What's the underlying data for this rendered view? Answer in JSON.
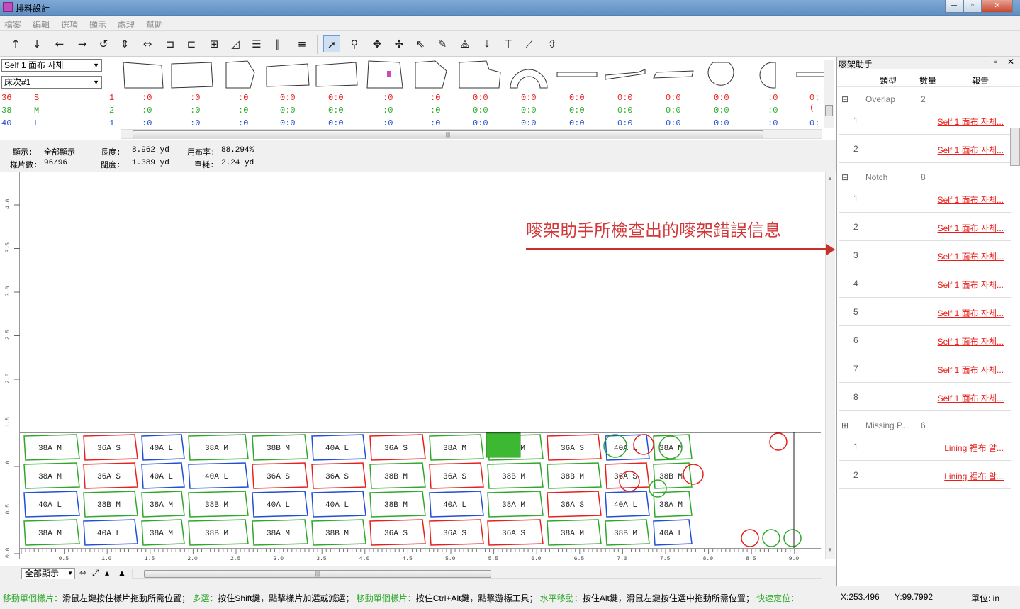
{
  "window": {
    "title": "排料設計",
    "min": "─",
    "max": "▫",
    "close": "✕"
  },
  "menu": [
    "檔案",
    "編輯",
    "選項",
    "顯示",
    "處理",
    "幫助"
  ],
  "combos": {
    "fabric": "Self 1 面布 자체",
    "batch": "床次#1"
  },
  "sizes": [
    {
      "code": "36",
      "label": "S",
      "count": "1",
      "color": "#e8201c"
    },
    {
      "code": "38",
      "label": "M",
      "count": "2",
      "color": "#2ea82a"
    },
    {
      "code": "40",
      "label": "L",
      "count": "1",
      "color": "#1f4fd6"
    }
  ],
  "size_cells": [
    ":0",
    ":0",
    ":0",
    "0:0",
    "0:0",
    ":0",
    ":0",
    "0:0",
    "0:0",
    "0:0",
    "0:0",
    "0:0",
    "0:0",
    ":0",
    "0:("
  ],
  "info": {
    "display_label": "顯示:",
    "display_value": "全部顯示",
    "length_label": "長度:",
    "length_value": "8.962 yd",
    "util_label": "用布率:",
    "util_value": "88.294%",
    "pieces_label": "樣片數:",
    "pieces_value": "96/96",
    "width_label": "闊度:",
    "width_value": "1.389 yd",
    "unit_label": "單耗:",
    "unit_value": "2.24 yd"
  },
  "note": "嘜架助手所檢查出的嘜架錯誤信息",
  "ruler_v": [
    "4.0",
    "3.5",
    "3.0",
    "2.5",
    "2.0",
    "1.5",
    "1.0",
    "0.5",
    "0.0"
  ],
  "ruler_h": [
    "0.5",
    "1.0",
    "1.5",
    "2.0",
    "2.5",
    "3.0",
    "3.5",
    "4.0",
    "4.5",
    "5.0",
    "5.5",
    "6.0",
    "6.5",
    "7.0",
    "7.5",
    "8.0",
    "8.5",
    "9.0"
  ],
  "bottom": {
    "view_select": "全部顯示"
  },
  "assistant": {
    "title": "嘜架助手",
    "col_type": "類型",
    "col_qty": "數量",
    "col_report": "報告",
    "groups": [
      {
        "name": "Overlap",
        "qty": "2",
        "toggle": "⊟",
        "rows": [
          {
            "n": "1",
            "report": "Self 1 面布 자체..."
          },
          {
            "n": "2",
            "report": "Self 1 面布 자체..."
          }
        ]
      },
      {
        "name": "Notch",
        "qty": "8",
        "toggle": "⊟",
        "rows": [
          {
            "n": "1",
            "report": "Self 1 面布 자체..."
          },
          {
            "n": "2",
            "report": "Self 1 面布 자체..."
          },
          {
            "n": "3",
            "report": "Self 1 面布 자체..."
          },
          {
            "n": "4",
            "report": "Self 1 面布 자체..."
          },
          {
            "n": "5",
            "report": "Self 1 面布 자체..."
          },
          {
            "n": "6",
            "report": "Self 1 面布 자체..."
          },
          {
            "n": "7",
            "report": "Self 1 面布 자체..."
          },
          {
            "n": "8",
            "report": "Self 1 面布 자체..."
          }
        ]
      },
      {
        "name": "Missing P...",
        "qty": "6",
        "toggle": "⊞",
        "rows": [
          {
            "n": "1",
            "report": "Lining 裡布 알..."
          },
          {
            "n": "2",
            "report": "Lining 裡布 알..."
          }
        ]
      }
    ]
  },
  "status": {
    "s1_title": "移動單個樣片：",
    "s1_text": "滑鼠左鍵按住樣片拖動所需位置；",
    "s2_title": "多選：",
    "s2_text": "按住Shift鍵，點擊樣片加選或減選；",
    "s3_title": "移動單個樣片：",
    "s3_text": "按住Ctrl+Alt鍵，點擊游標工具；",
    "s4_title": "水平移動：",
    "s4_text": "按住Alt鍵，滑鼠左鍵按住選中拖動所需位置；",
    "s5_title": "快速定位：",
    "x": "X:253.496",
    "y": "Y:99.7992",
    "unit": "單位: in"
  },
  "marker_pieces": [
    {
      "t": "38A M",
      "c": "g"
    },
    {
      "t": "36A S",
      "c": "r"
    },
    {
      "t": "40A L",
      "c": "b"
    },
    {
      "t": "38A M",
      "c": "g"
    },
    {
      "t": "38B M",
      "c": "g"
    },
    {
      "t": "40A L",
      "c": "b"
    },
    {
      "t": "36A S",
      "c": "r"
    },
    {
      "t": "38A M",
      "c": "g"
    },
    {
      "t": "38B M",
      "c": "g"
    },
    {
      "t": "36A S",
      "c": "r"
    },
    {
      "t": "40A L",
      "c": "b"
    },
    {
      "t": "38A M",
      "c": "g"
    },
    {
      "t": "38A M",
      "c": "g"
    },
    {
      "t": "36A S",
      "c": "r"
    },
    {
      "t": "40A L",
      "c": "b"
    },
    {
      "t": "40A L",
      "c": "b"
    },
    {
      "t": "36A S",
      "c": "r"
    },
    {
      "t": "36A S",
      "c": "r"
    },
    {
      "t": "38B M",
      "c": "g"
    },
    {
      "t": "36A S",
      "c": "r"
    },
    {
      "t": "38B M",
      "c": "g"
    },
    {
      "t": "38B M",
      "c": "g"
    },
    {
      "t": "36A S",
      "c": "r"
    },
    {
      "t": "38B M",
      "c": "g"
    },
    {
      "t": "40A L",
      "c": "b"
    },
    {
      "t": "38B M",
      "c": "g"
    },
    {
      "t": "38A M",
      "c": "g"
    },
    {
      "t": "38B M",
      "c": "g"
    },
    {
      "t": "40A L",
      "c": "b"
    },
    {
      "t": "40A L",
      "c": "b"
    },
    {
      "t": "38B M",
      "c": "g"
    },
    {
      "t": "40A L",
      "c": "b"
    },
    {
      "t": "38A M",
      "c": "g"
    },
    {
      "t": "36A S",
      "c": "r"
    },
    {
      "t": "40A L",
      "c": "b"
    },
    {
      "t": "38A M",
      "c": "g"
    },
    {
      "t": "38A M",
      "c": "g"
    },
    {
      "t": "40A L",
      "c": "b"
    },
    {
      "t": "38A M",
      "c": "g"
    },
    {
      "t": "38B M",
      "c": "g"
    },
    {
      "t": "38A M",
      "c": "g"
    },
    {
      "t": "38B M",
      "c": "g"
    },
    {
      "t": "36A S",
      "c": "r"
    },
    {
      "t": "36A S",
      "c": "r"
    },
    {
      "t": "36A S",
      "c": "r"
    },
    {
      "t": "38A M",
      "c": "g"
    },
    {
      "t": "38B M",
      "c": "g"
    },
    {
      "t": "40A L",
      "c": "b"
    }
  ]
}
